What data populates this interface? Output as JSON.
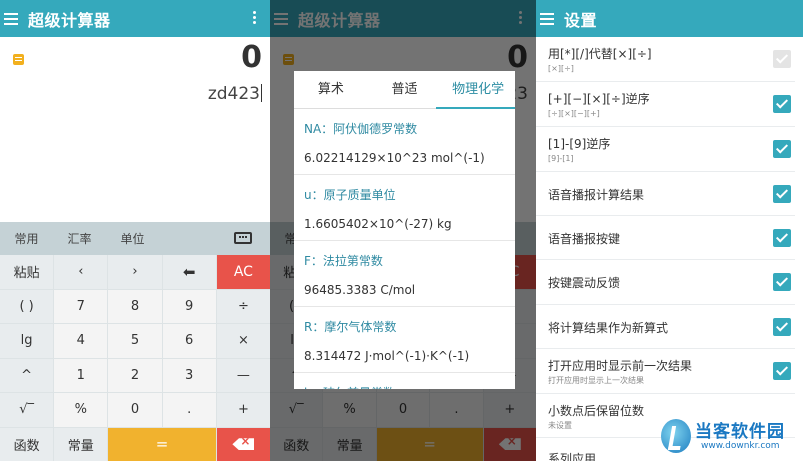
{
  "app": {
    "title": "超级计算器",
    "settings_title": "设置"
  },
  "calc": {
    "result": "0",
    "expression": "zd423",
    "tabs": [
      "常用",
      "汇率",
      "单位"
    ],
    "keys": [
      [
        "粘贴",
        "‹",
        "›",
        "⬅",
        "AC"
      ],
      [
        "( )",
        "7",
        "8",
        "9",
        "÷"
      ],
      [
        "lg",
        "4",
        "5",
        "6",
        "×"
      ],
      [
        "^",
        "1",
        "2",
        "3",
        "—"
      ],
      [
        "√‾",
        "%",
        "0",
        ".",
        "+"
      ],
      [
        "函数",
        "常量",
        "=",
        ""
      ]
    ]
  },
  "dialog": {
    "tabs": [
      "算术",
      "普适",
      "物理化学"
    ],
    "constants": [
      {
        "name": "NA：阿伏伽德罗常数",
        "value": "6.02214129×10^23 mol^(-1)"
      },
      {
        "name": "u：原子质量单位",
        "value": "1.6605402×10^(-27) kg"
      },
      {
        "name": "F：法拉第常数",
        "value": "96485.3383 C/mol"
      },
      {
        "name": "R：摩尔气体常数",
        "value": "8.314472 J·mol^(-1)·K^(-1)"
      },
      {
        "name": "k：玻尔兹曼常数",
        "value": ""
      }
    ]
  },
  "settings": [
    {
      "title": "用[*][/]代替[×][÷]",
      "sub": "[×][÷]",
      "checked": false
    },
    {
      "title": "[+][−][×][÷]逆序",
      "sub": "[÷][×][−][+]",
      "checked": true
    },
    {
      "title": "[1]-[9]逆序",
      "sub": "[9]-[1]",
      "checked": true
    },
    {
      "title": "语音播报计算结果",
      "sub": "",
      "checked": true
    },
    {
      "title": "语音播报按键",
      "sub": "",
      "checked": true
    },
    {
      "title": "按键震动反馈",
      "sub": "",
      "checked": true
    },
    {
      "title": "将计算结果作为新算式",
      "sub": "",
      "checked": true
    },
    {
      "title": "打开应用时显示前一次结果",
      "sub": "打开应用时显示上一次结果",
      "checked": true
    },
    {
      "title": "小数点后保留位数",
      "sub": "未设置",
      "checked": null
    },
    {
      "title": "系列应用",
      "sub": "",
      "checked": null
    }
  ],
  "watermark": {
    "name": "当客软件园",
    "url": "www.downkr.com"
  },
  "colors": {
    "accent": "#35a9bc",
    "ac": "#e8534a",
    "equals": "#f1b22e"
  }
}
